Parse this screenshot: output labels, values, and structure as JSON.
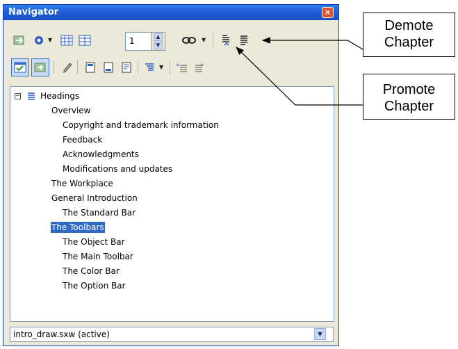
{
  "window": {
    "title": "Navigator",
    "close_label": "×"
  },
  "toolbar": {
    "page_number": "1"
  },
  "tree": {
    "root": "Headings",
    "items": [
      "Overview",
      "Copyright and trademark information",
      "Feedback",
      "Acknowledgments",
      "Modifications and updates",
      "The Workplace",
      "General Introduction",
      "The Standard Bar",
      "The Toolbars",
      "The Object Bar",
      "The Main Toolbar",
      "The Color Bar",
      "The Option Bar"
    ],
    "selected": "The Toolbars"
  },
  "document_selector": {
    "value": "intro_draw.sxw (active)"
  },
  "callouts": {
    "demote": [
      "Demote",
      "Chapter"
    ],
    "promote": [
      "Promote",
      "Chapter"
    ]
  },
  "colors": {
    "titlebar": "#1f5fd6",
    "selection": "#316ac5",
    "window_bg": "#ece9d8"
  }
}
